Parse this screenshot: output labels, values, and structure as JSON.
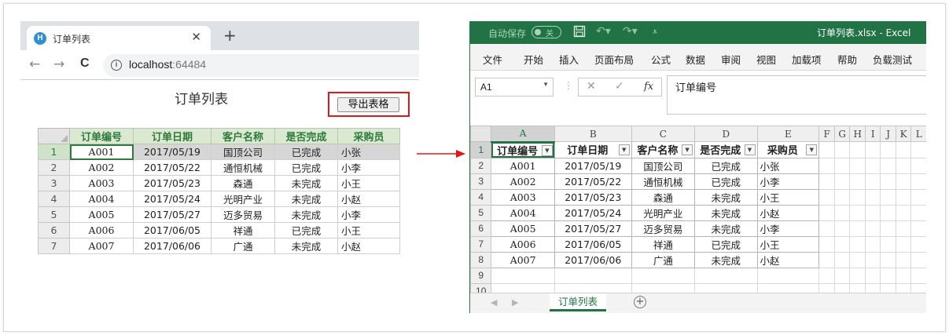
{
  "browser": {
    "tab_title": "订单列表",
    "favicon_letter": "H",
    "close_glyph": "✕",
    "new_tab_glyph": "+",
    "back_glyph": "←",
    "forward_glyph": "→",
    "reload_glyph": "C",
    "info_glyph": "i",
    "url_host": "localhost",
    "url_port": ":64484"
  },
  "page": {
    "title": "订单列表",
    "export_button": "导出表格"
  },
  "orders": {
    "columns": [
      "订单编号",
      "订单日期",
      "客户名称",
      "是否完成",
      "采购员"
    ],
    "rows": [
      [
        "A001",
        "2017/05/19",
        "国顶公司",
        "已完成",
        "小张"
      ],
      [
        "A002",
        "2017/05/22",
        "通恒机械",
        "已完成",
        "小李"
      ],
      [
        "A003",
        "2017/05/23",
        "森通",
        "未完成",
        "小王"
      ],
      [
        "A004",
        "2017/05/24",
        "光明产业",
        "未完成",
        "小赵"
      ],
      [
        "A005",
        "2017/05/27",
        "迈多贸易",
        "未完成",
        "小李"
      ],
      [
        "A006",
        "2017/06/05",
        "祥通",
        "已完成",
        "小王"
      ],
      [
        "A007",
        "2017/06/06",
        "广通",
        "未完成",
        "小赵"
      ]
    ]
  },
  "excel": {
    "autosave_label": "自动保存",
    "autosave_state": "关",
    "filename": "订单列表.xlsx  -  Excel",
    "ribbon_tabs": [
      "文件",
      "开始",
      "插入",
      "页面布局",
      "公式",
      "数据",
      "审阅",
      "视图",
      "加载项",
      "帮助",
      "负载测试"
    ],
    "name_box": "A1",
    "formula_bar_label": "fx",
    "formula_content": "订单编号",
    "header_cells": [
      "订单编号",
      "订单日期",
      "客户名称",
      "是否完成",
      "采购员"
    ],
    "col_headers": [
      "A",
      "B",
      "C",
      "D",
      "E",
      "F",
      "G",
      "H",
      "I",
      "J",
      "K",
      "L"
    ],
    "row_numbers": [
      "1",
      "2",
      "3",
      "4",
      "5",
      "6",
      "7",
      "8",
      "9",
      "10"
    ],
    "sheet_tab": "订单列表",
    "add_sheet_glyph": "+"
  },
  "colors": {
    "excel_green": "#217346",
    "grid_header_green": "#2e7a3a",
    "export_highlight": "#e01818"
  }
}
